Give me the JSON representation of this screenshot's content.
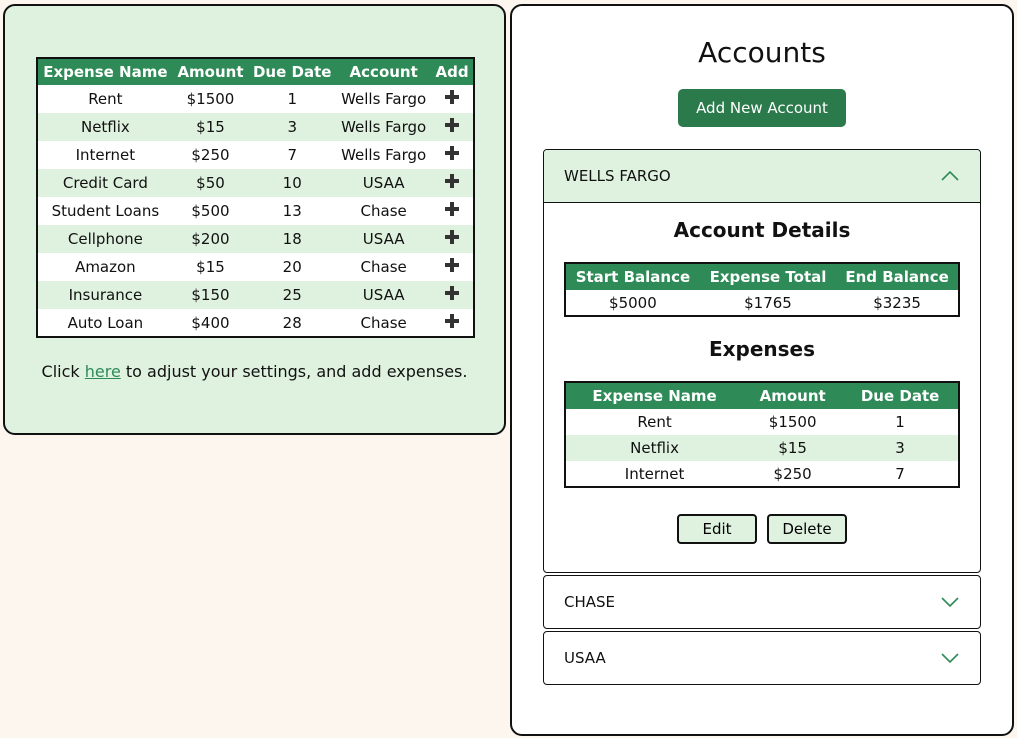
{
  "expenses_table": {
    "headers": [
      "Expense Name",
      "Amount",
      "Due Date",
      "Account",
      "Add"
    ],
    "rows": [
      {
        "name": "Rent",
        "amount": "$1500",
        "due": "1",
        "account": "Wells Fargo"
      },
      {
        "name": "Netflix",
        "amount": "$15",
        "due": "3",
        "account": "Wells Fargo"
      },
      {
        "name": "Internet",
        "amount": "$250",
        "due": "7",
        "account": "Wells Fargo"
      },
      {
        "name": "Credit Card",
        "amount": "$50",
        "due": "10",
        "account": "USAA"
      },
      {
        "name": "Student Loans",
        "amount": "$500",
        "due": "13",
        "account": "Chase"
      },
      {
        "name": "Cellphone",
        "amount": "$200",
        "due": "18",
        "account": "USAA"
      },
      {
        "name": "Amazon",
        "amount": "$15",
        "due": "20",
        "account": "Chase"
      },
      {
        "name": "Insurance",
        "amount": "$150",
        "due": "25",
        "account": "USAA"
      },
      {
        "name": "Auto Loan",
        "amount": "$400",
        "due": "28",
        "account": "Chase"
      }
    ],
    "add_icon": "plus-icon"
  },
  "note": {
    "prefix": "Click ",
    "link_text": "here",
    "suffix": " to adjust your settings, and add expenses."
  },
  "accounts_panel": {
    "title": "Accounts",
    "add_button_label": "Add New Account",
    "accounts": [
      {
        "name": "WELLS FARGO",
        "expanded": true,
        "chevron_icon": "chevron-up-icon",
        "details_title": "Account Details",
        "details_headers": [
          "Start Balance",
          "Expense Total",
          "End Balance"
        ],
        "details_values": [
          "$5000",
          "$1765",
          "$3235"
        ],
        "expenses_title": "Expenses",
        "expenses_headers": [
          "Expense Name",
          "Amount",
          "Due Date"
        ],
        "expenses_rows": [
          [
            "Rent",
            "$1500",
            "1"
          ],
          [
            "Netflix",
            "$15",
            "3"
          ],
          [
            "Internet",
            "$250",
            "7"
          ]
        ],
        "edit_label": "Edit",
        "delete_label": "Delete"
      },
      {
        "name": "CHASE",
        "expanded": false,
        "chevron_icon": "chevron-down-icon"
      },
      {
        "name": "USAA",
        "expanded": false,
        "chevron_icon": "chevron-down-icon"
      }
    ]
  },
  "colors": {
    "accent_green": "#2e8b57",
    "button_green": "#2a7a4b",
    "light_green": "#dff2df",
    "page_bg": "#fdf6ef"
  }
}
